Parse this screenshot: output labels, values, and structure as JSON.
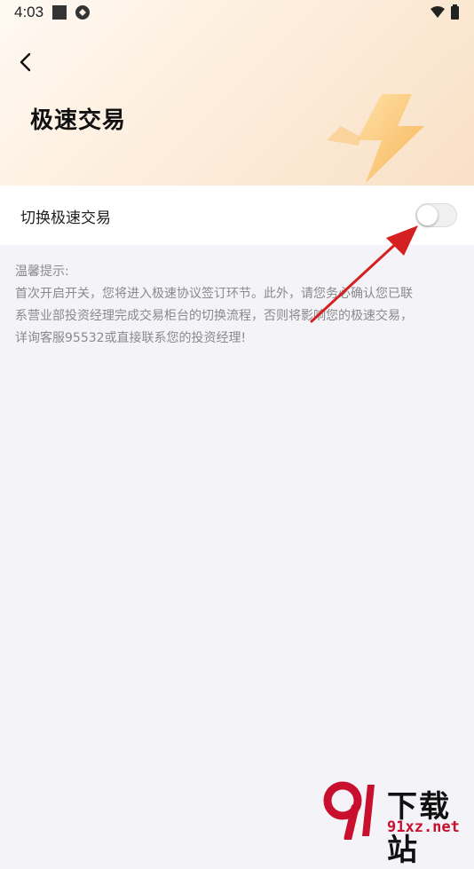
{
  "status_bar": {
    "time": "4:03"
  },
  "header": {
    "title": "极速交易"
  },
  "setting_row": {
    "label": "切换极速交易",
    "toggle_on": false
  },
  "tip": {
    "heading": "温馨提示:",
    "lines": [
      "首次开启开关，您将进入极速协议签订环节。此外，请您务必确认您已联",
      "系营业部投资经理完成交易柜台的切换流程，否则将影响您的极速交易，",
      "详询客服95532或直接联系您的投资经理!"
    ]
  },
  "watermark": {
    "brand": "下载站",
    "domain": "91xz.net"
  },
  "colors": {
    "arrow": "#d42020",
    "background": "#f4f4f8",
    "tip_text": "#8a8a8a"
  }
}
